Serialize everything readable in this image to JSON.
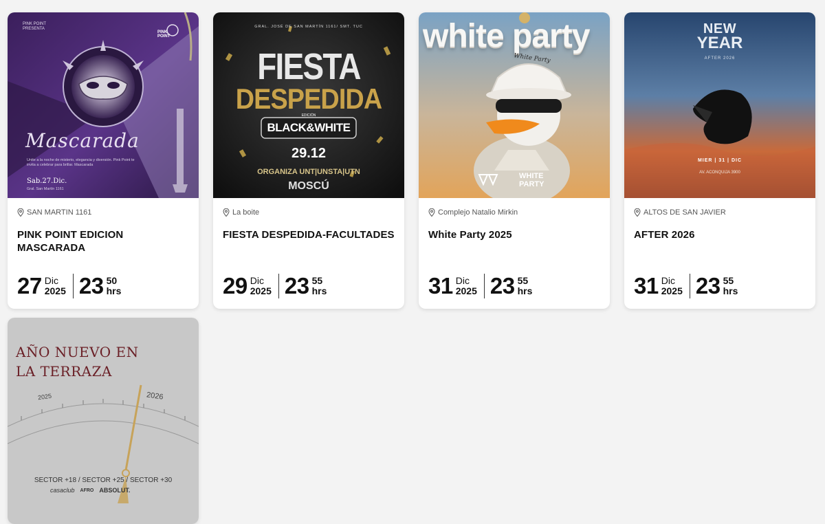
{
  "events": [
    {
      "poster": {
        "top_left_line1": "PINK POINT",
        "top_left_line2": "PRESENTA",
        "logo": "PINK POINT",
        "script_title": "Mascarada",
        "desc": "Unite a la noche de misterio, elegancia y diversión. Pink Point te invita a celebrar para brillar. Mascarada",
        "date_line": "Sab.27.Dic.",
        "address": "Gral. San Martín 1161"
      },
      "venue": "SAN MARTIN 1161",
      "title": "PINK POINT EDICION MASCARADA",
      "day": "27",
      "month": "Dic",
      "year": "2025",
      "hour": "23",
      "minutes": "50",
      "hrs": "hrs"
    },
    {
      "poster": {
        "address": "GRAL. JOSÉ DE SAN MARTÍN 1161/ SMT. TUC",
        "line1": "FIESTA",
        "line2": "DESPEDIDA",
        "edition": "EDICIÓN",
        "badge": "BLACK&WHITE",
        "date": "29.12",
        "organiza": "ORGANIZA UNT|UNSTA|UTN",
        "brand": "MOSCÚ"
      },
      "venue": "La boite",
      "title": "FIESTA DESPEDIDA-FACULTADES",
      "day": "29",
      "month": "Dic",
      "year": "2025",
      "hour": "23",
      "minutes": "55",
      "hrs": "hrs"
    },
    {
      "poster": {
        "big_word": "white party",
        "hat_text": "White Party",
        "logo_right": "WHITE PARTY"
      },
      "venue": "Complejo Natalio Mirkin",
      "title": "White Party 2025",
      "day": "31",
      "month": "Dic",
      "year": "2025",
      "hour": "23",
      "minutes": "55",
      "hrs": "hrs"
    },
    {
      "poster": {
        "line1": "NEW",
        "line2": "YEAR",
        "sub": "AFTER 2026",
        "date": "MIER | 31 | DIC",
        "place": "AV. ACONQUIJA 3900"
      },
      "venue": "ALTOS DE SAN JAVIER",
      "title": "AFTER 2026",
      "day": "31",
      "month": "Dic",
      "year": "2025",
      "hour": "23",
      "minutes": "55",
      "hrs": "hrs"
    },
    {
      "poster": {
        "line1": "AÑO NUEVO EN",
        "line2": "LA TERRAZA",
        "year_left": "2025",
        "year_right": "2026",
        "sectors": "SECTOR +18 / SECTOR +25 / SECTOR +30",
        "sponsor1": "casaclub",
        "sponsor2": "AFRO",
        "sponsor3": "ABSOLUT."
      }
    }
  ],
  "colors": {
    "page_bg": "#f3f3f3",
    "card_bg": "#ffffff",
    "text": "#111111",
    "muted": "#555555"
  }
}
